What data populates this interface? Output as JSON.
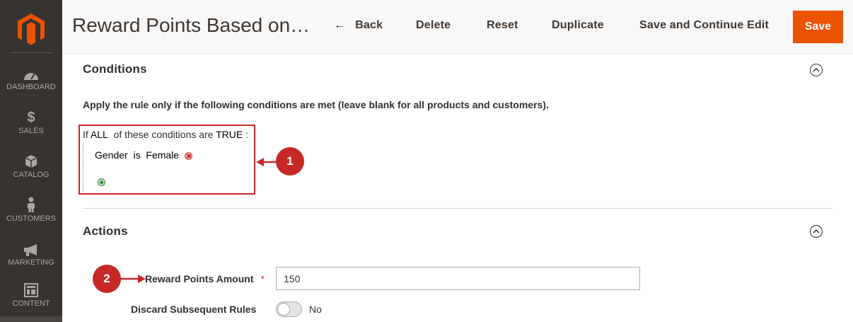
{
  "header": {
    "title": "Reward Points Based on…",
    "back_label": "Back",
    "delete_label": "Delete",
    "reset_label": "Reset",
    "duplicate_label": "Duplicate",
    "save_continue_label": "Save and Continue Edit",
    "save_label": "Save"
  },
  "sidebar": {
    "items": [
      {
        "label": "DASHBOARD",
        "icon": "dashboard-icon"
      },
      {
        "label": "SALES",
        "icon": "dollar-icon"
      },
      {
        "label": "CATALOG",
        "icon": "box-icon"
      },
      {
        "label": "CUSTOMERS",
        "icon": "person-icon"
      },
      {
        "label": "MARKETING",
        "icon": "megaphone-icon"
      },
      {
        "label": "CONTENT",
        "icon": "layout-icon"
      }
    ]
  },
  "conditions": {
    "title": "Conditions",
    "description": "Apply the rule only if the following conditions are met (leave blank for all products and customers).",
    "prefix": "If",
    "aggregator": "ALL",
    "middle": "of these conditions are",
    "value": "TRUE",
    "suffix": ":",
    "row": {
      "attribute": "Gender",
      "operator": "is",
      "value": "Female"
    }
  },
  "actions": {
    "title": "Actions",
    "reward_label": "Reward Points Amount",
    "required_mark": "*",
    "reward_value": "150",
    "discard_label": "Discard Subsequent Rules",
    "discard_value": "No"
  },
  "annotations": {
    "badge1": "1",
    "badge2": "2"
  },
  "colors": {
    "accent": "#eb5202",
    "sidebar": "#373330",
    "annotation": "#c62828"
  }
}
